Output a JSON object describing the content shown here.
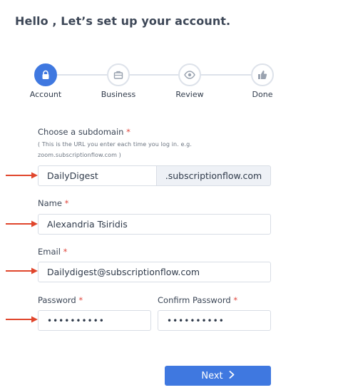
{
  "title": "Hello , Let’s set up your account.",
  "steps": [
    {
      "label": "Account",
      "icon": "lock-icon",
      "active": true
    },
    {
      "label": "Business",
      "icon": "briefcase-icon",
      "active": false
    },
    {
      "label": "Review",
      "icon": "eye-icon",
      "active": false
    },
    {
      "label": "Done",
      "icon": "thumbs-up-icon",
      "active": false
    }
  ],
  "form": {
    "subdomain": {
      "label": "Choose a subdomain",
      "required_mark": "*",
      "hint": "( This is the URL you enter each time you log in. e.g. zoom.subscriptionflow.com )",
      "value": "DailyDigest",
      "suffix": ".subscriptionflow.com"
    },
    "name": {
      "label": "Name",
      "required_mark": "*",
      "value": "Alexandria Tsiridis"
    },
    "email": {
      "label": "Email",
      "required_mark": "*",
      "value": "Dailydigest@subscriptionflow.com"
    },
    "password": {
      "label": "Password",
      "required_mark": "*",
      "value": "••••••••••"
    },
    "confirm_password": {
      "label": "Confirm Password",
      "required_mark": "*",
      "value": "••••••••••"
    }
  },
  "next_button": {
    "label": "Next",
    "icon": "chevron-right-icon"
  },
  "colors": {
    "accent": "#3f78e0",
    "arrow": "#e0462c",
    "required": "#e0463c"
  }
}
